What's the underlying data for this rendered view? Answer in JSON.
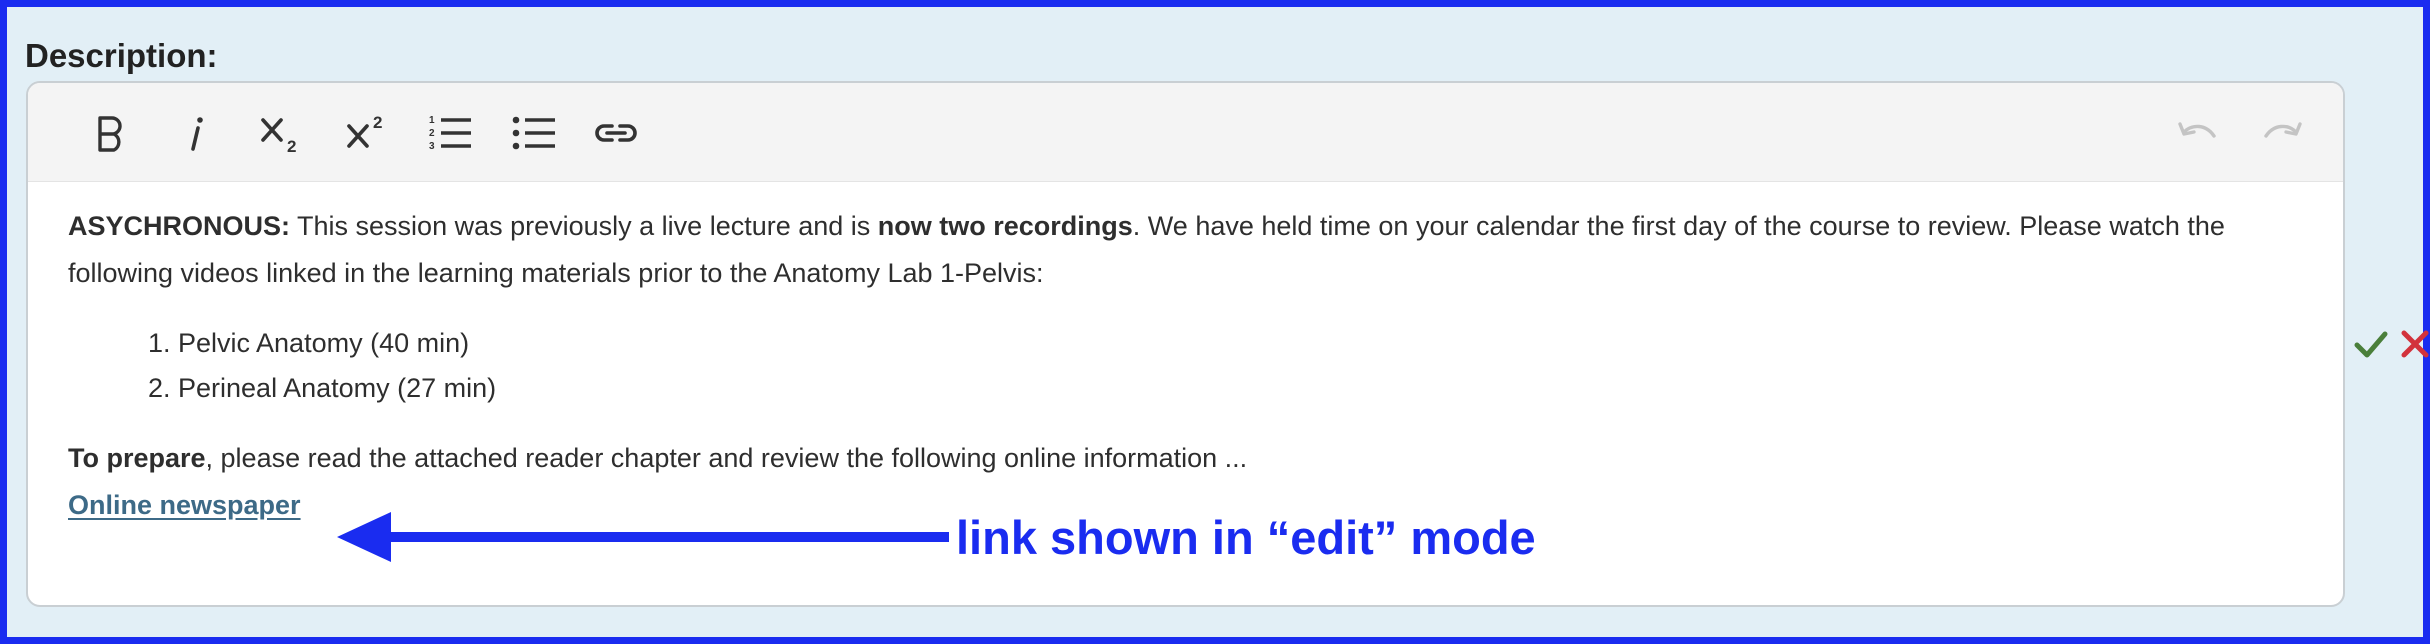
{
  "field": {
    "label": "Description:"
  },
  "toolbar": {
    "buttons": [
      {
        "name": "bold-icon",
        "title": "Bold"
      },
      {
        "name": "italic-icon",
        "title": "Italic"
      },
      {
        "name": "subscript-icon",
        "title": "Subscript"
      },
      {
        "name": "superscript-icon",
        "title": "Superscript"
      },
      {
        "name": "numbered-list-icon",
        "title": "Numbered list"
      },
      {
        "name": "bulleted-list-icon",
        "title": "Bulleted list"
      },
      {
        "name": "link-icon",
        "title": "Link"
      },
      {
        "name": "undo-icon",
        "title": "Undo"
      },
      {
        "name": "redo-icon",
        "title": "Redo"
      }
    ]
  },
  "content": {
    "para1": {
      "lead_bold": "ASYCHRONOUS:",
      "text_a": " This session was previously a live lecture and is ",
      "bold_mid": "now two recordings",
      "text_b": ".  We have held time on your calendar the first day of the course to review.  Please watch the following videos linked in the learning materials prior to the Anatomy Lab 1-Pelvis:"
    },
    "list_items": [
      "Pelvic Anatomy (40 min)",
      "Perineal Anatomy (27 min)"
    ],
    "para2": {
      "lead_bold": "To prepare",
      "text": ", please read the attached reader chapter and review the following online information ..."
    },
    "link_text": "Online newspaper"
  },
  "annotation": {
    "text": "link shown in “edit” mode"
  },
  "actions": {
    "confirm_icon": "check-icon",
    "cancel_icon": "close-icon"
  },
  "colors": {
    "annotation_blue": "#1a2cf0",
    "panel_bg": "#e2eff6",
    "link": "#3d6a87",
    "confirm_green": "#4a7f3a",
    "cancel_red": "#d2323c"
  }
}
